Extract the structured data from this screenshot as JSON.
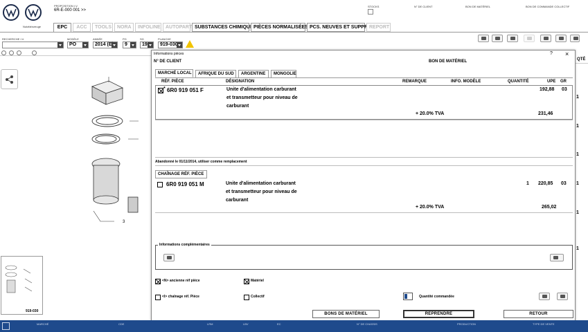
{
  "header": {
    "brand_text": "Nutzfahrzeuge",
    "proposition_label": "PROPOSITION I.V.",
    "proposition_value": "6R-E-000 001 >>",
    "stocks_label": "STOCKS",
    "client_label": "N° DE CLIENT",
    "bon_materiel_label": "BON DE MATÉRIEL",
    "bon_collectif_label": "BON DE COMMANDE COLLECTIF"
  },
  "tabs": [
    "EPC",
    "ACC",
    "TOOLS",
    "NORA",
    "INFOLINE",
    "AUTOPART",
    "SUBSTANCES CHIMIQUES",
    "PIÈCES NORMALISÉES",
    "PCS. NEUVES ET SUPPR.",
    "REPORT"
  ],
  "filters": {
    "search_label": "RECHERCHE I.V.",
    "model_label": "MODÈLE",
    "model_value": "PO",
    "year_label": "ANNÉE",
    "year_value": "2014 (E)",
    "pg_label": "PG",
    "pg_value": "9",
    "sg_label": "SG",
    "sg_value": "19",
    "planche_label": "PLANCHE",
    "planche_value": "919-030"
  },
  "left_panel": {
    "share_icon": "share-icon",
    "thumb_label": "919-030",
    "callout_a": "1",
    "callout_b": "3"
  },
  "right_column": {
    "header": "QTÉ",
    "values": [
      "1",
      "1",
      "1",
      "1",
      "1",
      "1"
    ]
  },
  "dialog": {
    "title": "Informations pièces",
    "help_text": "?",
    "close_text": "×",
    "client_label": "N° DE CLIENT",
    "bon_label": "BON DE MATÉRIEL",
    "market_tabs": [
      "MARCHÉ LOCAL",
      "AFRIQUE DU SUD",
      "ARGENTINE",
      "MONGOLIE"
    ],
    "columns": {
      "ref": "RÉF. PIÈCE",
      "designation": "DÉSIGNATION",
      "remarque": "REMARQUE",
      "info_modele": "INFO. MODÈLE",
      "quantite": "QUANTITÉ",
      "upe": "UPE",
      "gr": "GR"
    },
    "part1": {
      "star": "*",
      "ref": "6R0 919 051 F",
      "designation_lines": [
        "Unite d'alimentation carburant",
        "et transmetteur pour niveau de",
        "carburant"
      ],
      "upe": "192,88",
      "gr": "03",
      "tva_label": "+ 20.0% TVA",
      "tva_price": "231,46"
    },
    "notice": "Abandonné le 01/11/2014, utiliser comme remplacement",
    "chain_tab": "CHAÎNAGE RÉF. PIÈCE",
    "part2": {
      "ref": "6R0 919 051 M",
      "designation_lines": [
        "Unite d'alimentation carburant",
        "et transmetteur pour niveau de",
        "carburant"
      ],
      "quantite": "1",
      "upe": "220,85",
      "gr": "03",
      "tva_label": "+ 20.0% TVA",
      "tva_price": "265,02"
    },
    "info_comp_label": "Informations complémentaires",
    "options": {
      "ancienne": "<N> ancienne réf pièce",
      "materiel": "Matériel",
      "chainage": "<I> chaînage réf. Pièce",
      "collectif": "Collectif",
      "quantite_cmd": "Quantité commandée"
    },
    "buttons": {
      "bons": "BONS DE MATÉRIEL",
      "reprendre": "REPRENDRE",
      "retour": "RETOUR"
    }
  },
  "footer": {
    "labels": [
      "MARCHÉ",
      "CDE",
      "LRM",
      "LBV",
      "EC",
      "N° DE CHASSIS",
      "PRODUCTION",
      "TYPE DE VENTE"
    ]
  },
  "colors": {
    "footer_bg": "#1e4a8c",
    "accent": "#1e4a8c",
    "warning": "#f2c400"
  }
}
